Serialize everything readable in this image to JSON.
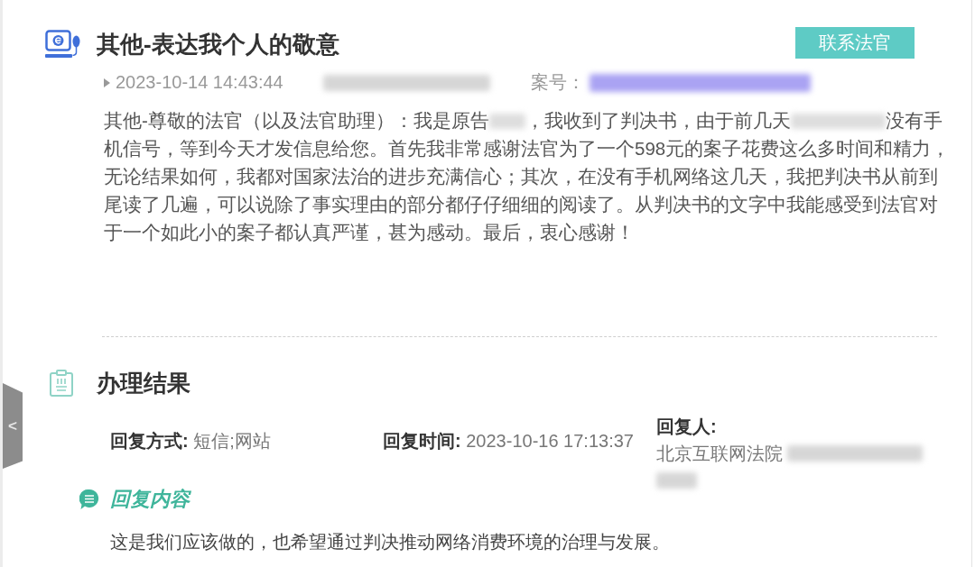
{
  "case": {
    "title": "其他-表达我个人的敬意",
    "contact_button": "联系法官",
    "meta": [
      {
        "kind": "date",
        "text": "2023-10-14 14:43:44"
      },
      {
        "kind": "redacted"
      },
      {
        "kind": "label",
        "text": "案号："
      },
      {
        "kind": "redacted_link"
      }
    ],
    "message": [
      {
        "kind": "text",
        "text": "其他-尊敬的法官（以及法官助理）：我是原告"
      },
      {
        "kind": "redacted"
      },
      {
        "kind": "text",
        "text": "，我收到了判决书，由于前几天"
      },
      {
        "kind": "redacted"
      },
      {
        "kind": "text",
        "text": "没有手机信号，等到今天才发信息给您。首先我非常感谢法官为了一个598元的案子花费这么多时间和精力，无论结果如何，我都对国家法治的进步充满信心；其次，在没有手机网络这几天，我把判决书从前到尾读了几遍，可以说除了事实理由的部分都仔仔细细的阅读了。从判决书的文字中我能感受到法官对于一个如此小的案子都认真严谨，甚为感动。最后，衷心感谢！"
      }
    ]
  },
  "result": {
    "title": "办理结果",
    "fields": [
      {
        "kind": "inline",
        "label": "回复方式:",
        "value": "短信;网站",
        "redacted": false
      },
      {
        "kind": "inline",
        "label": "回复时间:",
        "value": "2023-10-16 17:13:37",
        "redacted": false
      },
      {
        "kind": "stacked",
        "label": "回复人:",
        "value": "北京互联网法院",
        "redacted": true
      }
    ],
    "reply_heading": "回复内容",
    "reply_text": "这是我们应该做的，也希望通过判决推动网络消费环境的治理与发展。"
  },
  "side_tab": {
    "label": "<"
  }
}
